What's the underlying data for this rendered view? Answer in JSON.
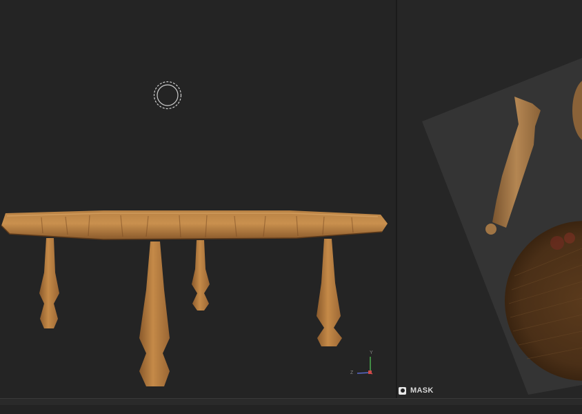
{
  "viewport_3d": {
    "gizmo": {
      "axis_y": "Y",
      "axis_z": "Z"
    }
  },
  "uv_view": {
    "mask_label": "MASK"
  },
  "colors": {
    "wood_light": "#c58a48",
    "wood_mid": "#a8713a",
    "wood_dark": "#6e4622",
    "axis_y": "#4caf50",
    "axis_z": "#5a6acd",
    "axis_x": "#d04a4a"
  },
  "icons": [
    "brush-cursor-icon",
    "axis-gizmo-icon",
    "mask-toggle-icon"
  ]
}
